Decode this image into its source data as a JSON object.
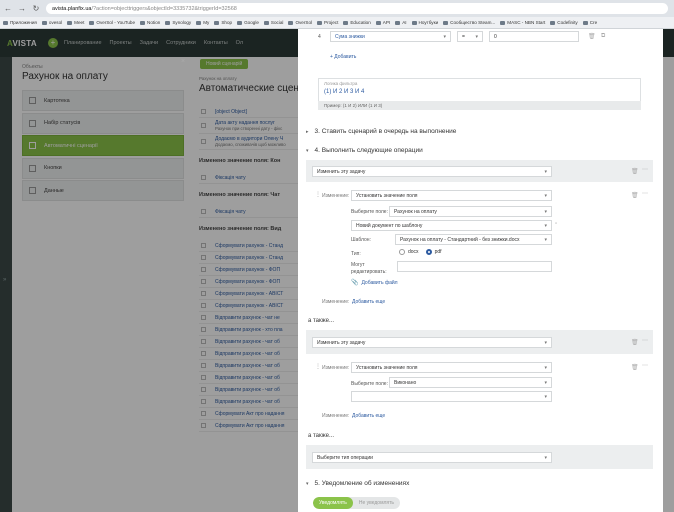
{
  "browser": {
    "url_host": "avista.planfix.ua",
    "url_rest": "/?action=objecttriggers&objectId=3335732&triggerId=32568",
    "bookmarks": [
      "Приложения",
      "ovesol",
      "Meet",
      "OverSol - YouTube",
      "Notion",
      "Synology",
      "My",
      "Shop",
      "Google",
      "Social",
      "OverSol",
      "Project",
      "Education",
      "API",
      "AI",
      "Ноутбуки",
      "Сообщество Steam...",
      "MASC - NBN Start",
      "Codefinity",
      "Cre"
    ]
  },
  "app": {
    "logo_a": "A",
    "logo_rest": "VISTA",
    "nav": [
      "Планирование",
      "Проекты",
      "Задачи",
      "Сотрудники",
      "Контакты",
      "Ол"
    ]
  },
  "left": {
    "entity": "Объекты",
    "title": "Рахунок на оплату",
    "items": [
      {
        "label": "Картотека",
        "active": false
      },
      {
        "label": "Набір статусів",
        "active": false
      },
      {
        "label": "Автоматичні сценарії",
        "active": true
      },
      {
        "label": "Кнопки",
        "active": false
      },
      {
        "label": "Данные",
        "active": false
      }
    ]
  },
  "middle": {
    "new_btn": "Новий сценарій",
    "subtitle": "Рахунок на оплату",
    "title": "Автоматические сцена",
    "rows_a": [
      {
        "text": "Фіксація аудиторa",
        "sub": ""
      },
      {
        "text": "Дата акту надання послуг",
        "sub": "Рахунок при створенні дату - фікс"
      },
      {
        "text": "Додаємо в аудитори Олену Ч",
        "sub": "Додаємо, споживачів щоб можливо"
      }
    ],
    "head1": "Изменено значение поля: Кон",
    "rows_b": [
      "Фіксація чату"
    ],
    "head2": "Изменено значение поля: Чат",
    "rows_c": [
      "Фіксація чату"
    ],
    "head3": "Изменено значение поля: Вид",
    "rows_d": [
      "Сформувати рахунок - Станд",
      "Сформувати рахунок - Станд",
      "Сформувати рахунок - ФОП",
      "Сформувати рахунок - ФОП",
      "Сформувати рахунок - АВІСТ",
      "Сформувати рахунок - АВІСТ",
      "Відправити рахунок - чат не",
      "Відправити рахунок - хто пла",
      "Відправити рахунок - чат об",
      "Відправити рахунок - чат об",
      "Відправити рахунок - чат об",
      "Відправити рахунок - чат об",
      "Відправити рахунок - чат об",
      "Відправити рахунок - чат об",
      "Сформувати Акт про надання",
      "Сформувати Акт про надання"
    ]
  },
  "modal": {
    "filter_num": "4",
    "filter_field": "Сума знижки",
    "filter_op": "=",
    "filter_val": "0",
    "add_link": "+ Добавить",
    "logic_label": "Логика фильтра",
    "logic_value": "(1) И 2 И 3 И 4",
    "logic_example": "Пример: (1 И 2) ИЛИ (1 И 3)",
    "sec3": "3. Ставить сценарий в очередь на выполнение",
    "sec4": "4. Выполнить следующие операции",
    "op1_select": "Изменить эту задачу",
    "change_label": "Изменение:",
    "set_value": "Установить значение поля",
    "choose_field_label": "Выберите поле:",
    "choose_field_value": "Рахунок на оплату",
    "new_doc": "Новий документ по шаблону",
    "template_label": "Шаблон:",
    "template_value": "Рахунок на оплату - Стандартний - без знижки.docx",
    "type_label": "Тип:",
    "type_docx": "docx",
    "type_pdf": "pdf",
    "can_edit_label": "Могут редактировать:",
    "add_file": "Добавить файл",
    "add_more": "Добавить еще",
    "also": "а также...",
    "op2_select": "Изменить эту задачу",
    "set_value2": "Установить значение поля",
    "choose_field_value2": "Виконано",
    "add_more2": "Добавить еще",
    "also2": "а также...",
    "op3_select": "Выберите тип операции",
    "sec5": "5. Уведомление об изменениях",
    "notify_on": "Уведомлять",
    "notify_off": "Не уведомлять"
  },
  "colors": {
    "accent": "#8bc34a",
    "link": "#2c5aa0",
    "appbar": "#2d3a38"
  }
}
